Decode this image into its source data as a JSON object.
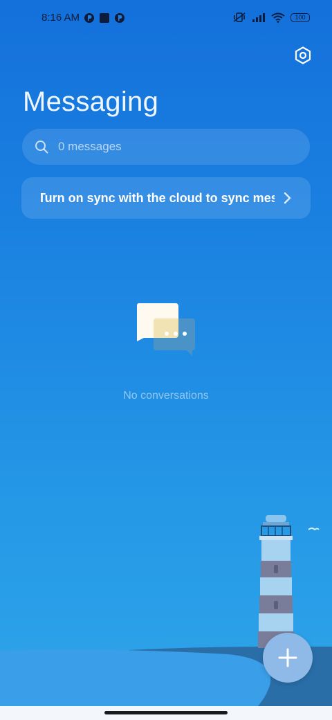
{
  "status_bar": {
    "time": "8:16 AM",
    "battery": "100"
  },
  "header": {
    "title": "Messaging"
  },
  "search": {
    "placeholder": "0 messages"
  },
  "sync_banner": {
    "text": "Turn on sync with the cloud to sync messages"
  },
  "empty_state": {
    "text": "No conversations"
  },
  "colors": {
    "background_top": "#1470db",
    "background_bottom": "#2fa6ea",
    "fab": "#8fb9e6"
  },
  "icons": {
    "settings": "settings-hexagon-icon",
    "search": "search-icon",
    "chevron": "chevron-right-icon",
    "fab": "plus-icon"
  }
}
